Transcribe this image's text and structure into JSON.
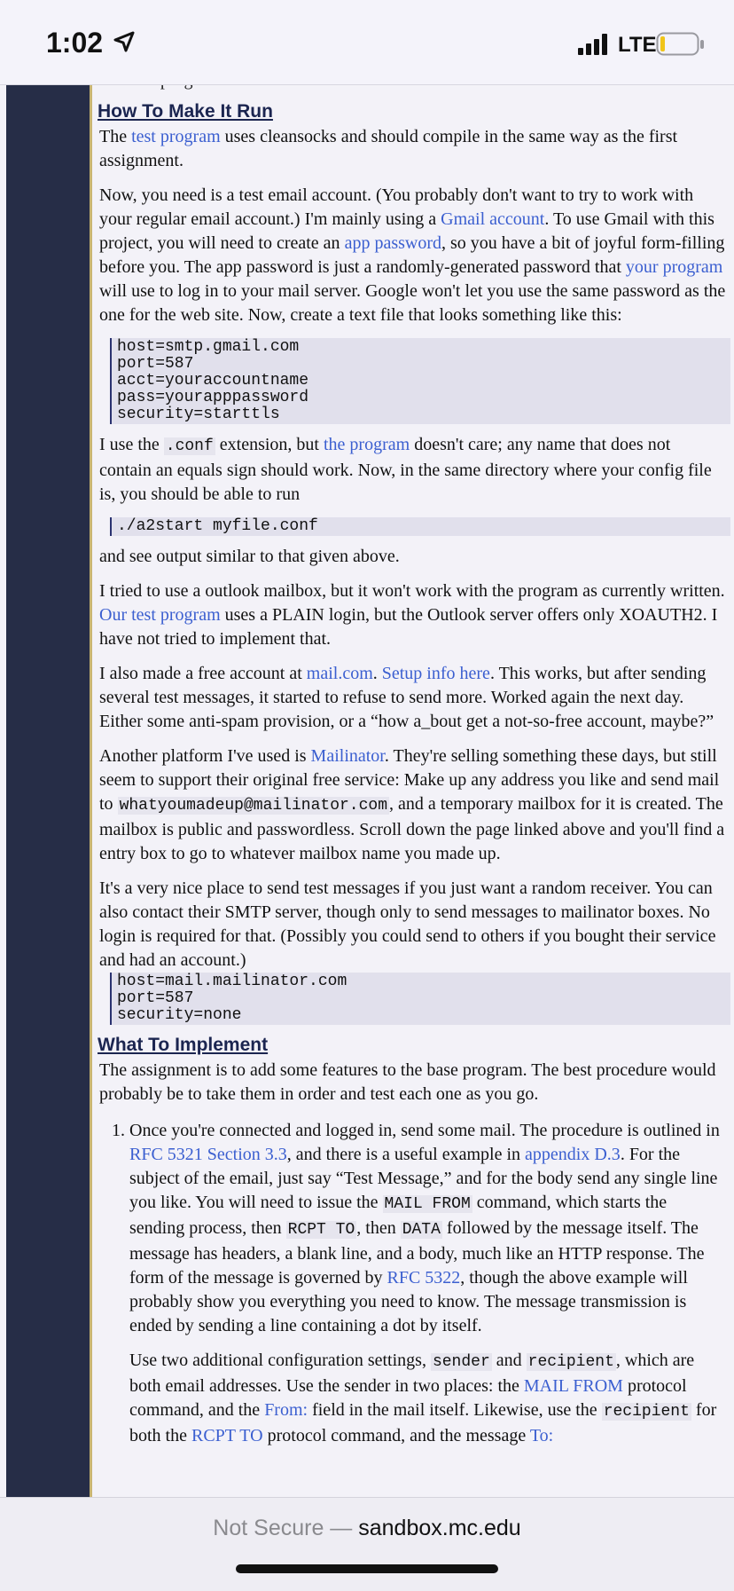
{
  "status_bar": {
    "time": "1:02",
    "network": "LTE"
  },
  "article": {
    "clipped_top_line": "now the program interacts with the server.",
    "section1_title": "How To Make It Run",
    "p1": {
      "t1": "The ",
      "l1": "test program",
      "t2": " uses cleansocks and should compile in the same way as the first assignment."
    },
    "p2": {
      "t1": "Now, you need is a test email account. (You probably don't want to try to work with your regular email account.) I'm mainly using a ",
      "l1": "Gmail account",
      "t2": ". To use Gmail with this project, you will need to create an ",
      "l2": "app password",
      "t3": ", so you have a bit of joyful form-filling before you. The app password is just a randomly-generated password that ",
      "l3": "your program",
      "t4": " will use to log in to your mail server. Google won't let you use the same password as the one for the web site. Now, create a text file that looks something like this:"
    },
    "code1": "host=smtp.gmail.com\nport=587\nacct=youraccountname\npass=yourapppassword\nsecurity=starttls",
    "p3": {
      "t1": "I use the ",
      "c1": ".conf",
      "t2": " extension, but ",
      "l1": "the program",
      "t3": " doesn't care; any name that does not contain an equals sign should work. Now, in the same directory where your config file is, you should be able to run"
    },
    "code2": "./a2start myfile.conf",
    "p4": "and see output similar to that given above.",
    "p5": {
      "t1": "I tried to use a outlook mailbox, but it won't work with the program as currently written. ",
      "l1": "Our test program",
      "t2": " uses a PLAIN login, but the Outlook server offers only XOAUTH2. I have not tried to implement that."
    },
    "p6": {
      "t1": "I also made a free account at ",
      "l1": "mail.com",
      "t2": ". ",
      "l2": "Setup info here",
      "t3": ". This works, but after sending several test messages, it started to refuse to send more. Worked again the next day. Either some anti-spam provision, or a “how a_bout get a not-so-free account, maybe?”"
    },
    "p7": {
      "t1": "Another platform I've used is ",
      "l1": "Mailinator",
      "t2": ". They're selling something these days, but still seem to support their original free service: Make up any address you like and send mail to ",
      "c1": "whatyoumadeup@mailinator.com",
      "t3": ", and a temporary mailbox for it is created. The mailbox is public and passwordless. Scroll down the page linked above and you'll find a entry box to go to whatever mailbox name you made up."
    },
    "p8": "It's a very nice place to send test messages if you just want a random receiver. You can also contact their SMTP server, though only to send messages to mailinator boxes. No login is required for that. (Possibly you could send to others if you bought their service and had an account.)",
    "code3": "host=mail.mailinator.com\nport=587\nsecurity=none",
    "section2_title": "What To Implement",
    "p9": "The assignment is to add some features to the base program. The best procedure would probably be to take them in order and test each one as you go.",
    "item1_p1": {
      "t1": "Once you're connected and logged in, send some mail. The procedure is outlined in ",
      "l1": "RFC 5321 Section 3.3",
      "t2": ", and there is a useful example in ",
      "l2": "appendix D.3",
      "t3": ". For the subject of the email, just say “Test Message,” and for the body send any single line you like. You will need to issue the ",
      "c1": "MAIL FROM",
      "t4": " command, which starts the sending process, then ",
      "c2": "RCPT TO",
      "t5": ", then ",
      "c3": "DATA",
      "t6": " followed by the message itself. The message has headers, a blank line, and a body, much like an HTTP response. The form of the message is governed by ",
      "l3": "RFC 5322",
      "t7": ", though the above example will probably show you everything you need to know. The message transmission is ended by sending a line containing a dot by itself."
    },
    "item1_p2": {
      "t1": "Use two additional configuration settings, ",
      "c1": "sender",
      "t2": " and ",
      "c2": "recipient",
      "t3": ", which are both email addresses. Use the sender in two places: the ",
      "l1": "MAIL FROM",
      "t4": " protocol command, and the ",
      "l2": "From:",
      "t5": " field in the mail itself. Likewise, use the ",
      "c3": "recipient",
      "t6": " for both the ",
      "l3": "RCPT TO",
      "t7": " protocol command, and the message ",
      "l4": "To:"
    }
  },
  "browser_bar": {
    "not_secure": "Not Secure — ",
    "domain": "sandbox.mc.edu"
  }
}
